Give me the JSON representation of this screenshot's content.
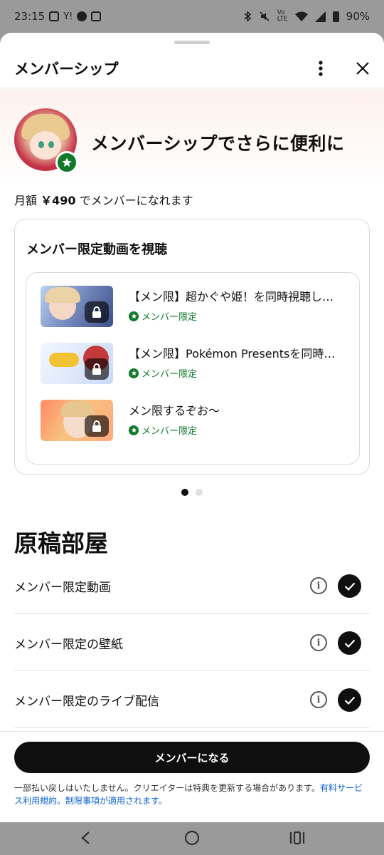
{
  "status_bar": {
    "time": "23:15",
    "battery": "90%",
    "left_icons": [
      "message-icon",
      "yahoo-icon",
      "line-icon",
      "plus-icon"
    ],
    "right_icons": [
      "bluetooth-icon",
      "mute-icon",
      "volte-icon",
      "wifi-icon",
      "signal-icon",
      "battery-icon"
    ]
  },
  "header": {
    "title": "メンバーシップ"
  },
  "hero": {
    "title": "メンバーシップでさらに便利に",
    "price_prefix": "月額 ",
    "price": "￥490",
    "price_suffix": " でメンバーになれます"
  },
  "card": {
    "title": "メンバー限定動画を視聴",
    "videos": [
      {
        "title": "【メン限】超かぐや姫！を同時視聴し…",
        "tag": "メンバー限定"
      },
      {
        "title": "【メン限】Pokémon Presentsを同時…",
        "tag": "メンバー限定"
      },
      {
        "title": "メン限するぞお～",
        "tag": "メンバー限定"
      }
    ],
    "page_index": 1,
    "page_count": 2
  },
  "tier": {
    "name": "原稿部屋",
    "perks": [
      {
        "label": "メンバー限定動画",
        "included": true
      },
      {
        "label": "メンバー限定の壁紙",
        "included": true
      },
      {
        "label": "メンバー限定のライブ配信",
        "included": true
      }
    ]
  },
  "footer": {
    "cta_label": "メンバーになる",
    "disclaimer_text": "一部払い戻しはいたしません。クリエイターは特典を更新する場合があります。",
    "link1": "有料サービス利用規約",
    "sep": "。",
    "link2": "制限事項",
    "disclaimer_end": "が適用されます。"
  },
  "colors": {
    "accent_green": "#107a2a",
    "cta_bg": "#0f0f0f",
    "link": "#065fd4"
  }
}
